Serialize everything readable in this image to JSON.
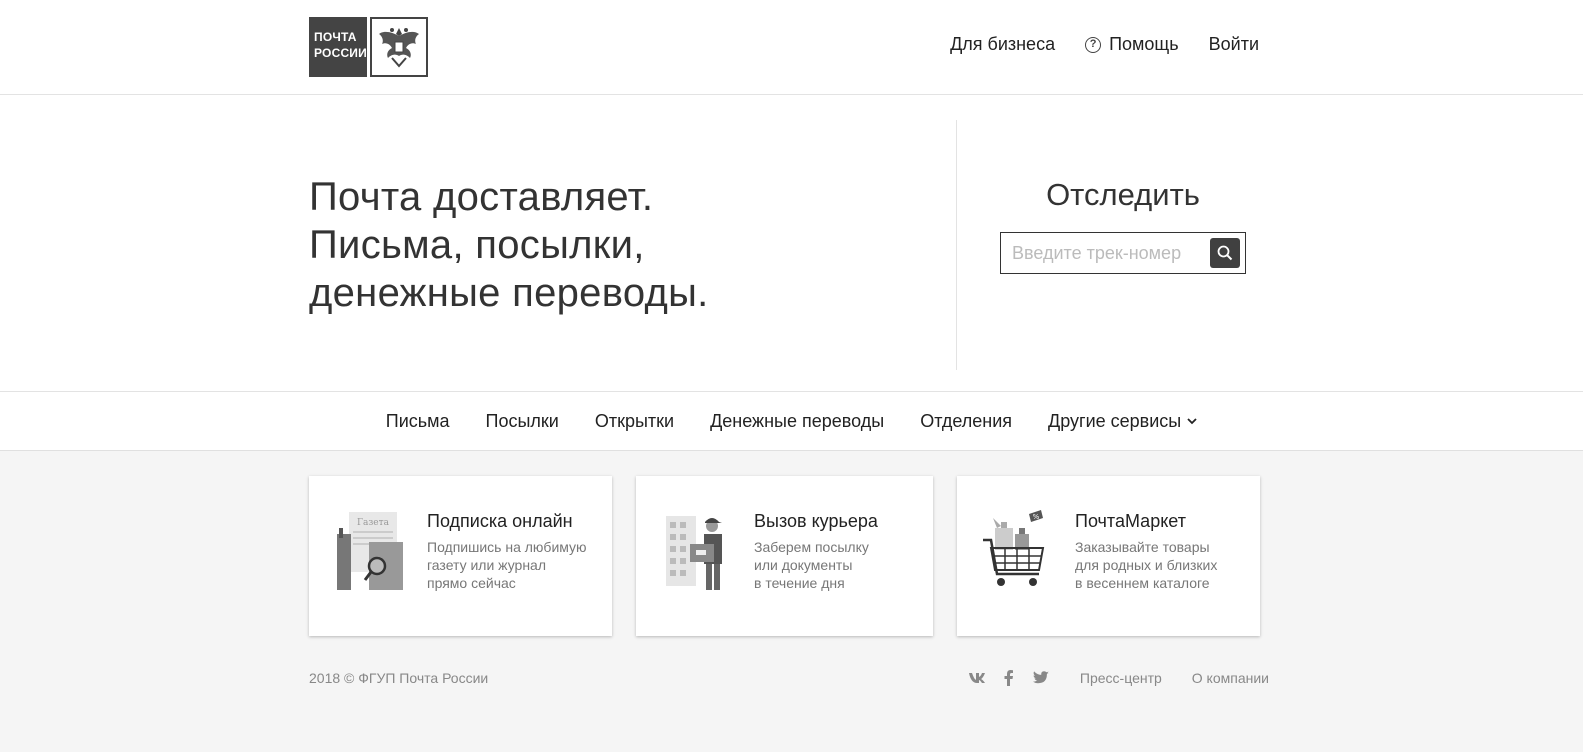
{
  "header": {
    "logo": {
      "line1": "ПОЧТА",
      "line2": "РОССИИ"
    },
    "links": {
      "business": "Для бизнеса",
      "help": "Помощь",
      "login": "Войти"
    },
    "help_icon_glyph": "?"
  },
  "hero": {
    "title_line1": "Почта доставляет.",
    "title_line2": "Письма, посылки,",
    "title_line3": "денежные переводы.",
    "track": {
      "title": "Отследить",
      "placeholder": "Введите трек-номер",
      "value": ""
    }
  },
  "menu": {
    "items": [
      "Письма",
      "Посылки",
      "Открытки",
      "Денежные переводы",
      "Отделения",
      "Другие сервисы"
    ]
  },
  "cards": [
    {
      "title": "Подписка онлайн",
      "desc1": "Подпишись на любимую",
      "desc2": "газету или журнал",
      "desc3": "прямо сейчас",
      "icon": "newspaper-icon",
      "illustration_text": "Газета"
    },
    {
      "title": "Вызов курьера",
      "desc1": "Заберем посылку",
      "desc2": "или документы",
      "desc3": "в течение дня",
      "icon": "courier-icon"
    },
    {
      "title": "ПочтаМаркет",
      "desc1": "Заказывайте товары",
      "desc2": "для родных и близких",
      "desc3": "в весеннем каталоге",
      "icon": "shopping-cart-icon",
      "illustration_text": "%"
    }
  ],
  "footer": {
    "copyright": "2018 © ФГУП Почта России",
    "links": {
      "press": "Пресс-центр",
      "about": "О компании"
    },
    "social": [
      "vk-icon",
      "facebook-icon",
      "twitter-icon"
    ]
  },
  "colors": {
    "dark": "#404040",
    "text": "#222222",
    "muted": "#888888",
    "background": "#f5f5f5"
  }
}
